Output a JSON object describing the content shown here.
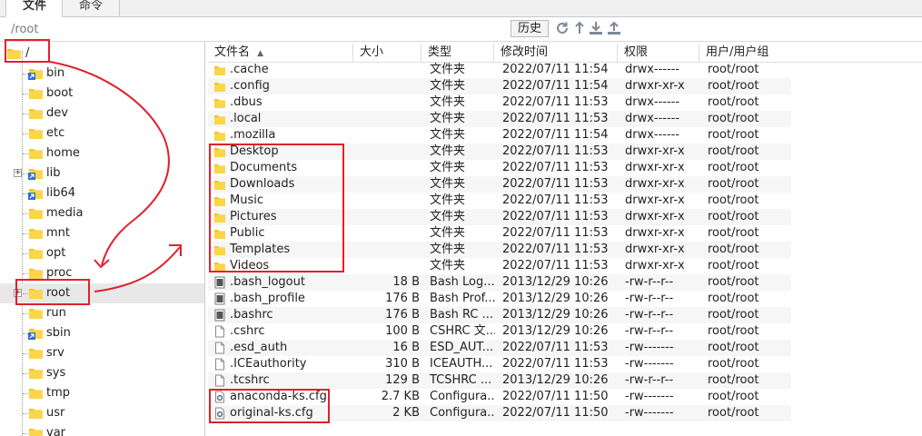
{
  "tabs": [
    {
      "label": "文件",
      "active": true
    },
    {
      "label": "命令",
      "active": false
    }
  ],
  "pathbar": {
    "path": "/root",
    "history_label": "历史"
  },
  "toolbar_icons": [
    "refresh-icon",
    "up-icon",
    "download-icon",
    "upload-icon"
  ],
  "tree": {
    "root_label": "/",
    "items": [
      {
        "label": "bin",
        "link": true,
        "expandable": false,
        "selected": false
      },
      {
        "label": "boot",
        "link": false,
        "expandable": false,
        "selected": false
      },
      {
        "label": "dev",
        "link": false,
        "expandable": false,
        "selected": false
      },
      {
        "label": "etc",
        "link": false,
        "expandable": false,
        "selected": false
      },
      {
        "label": "home",
        "link": false,
        "expandable": false,
        "selected": false
      },
      {
        "label": "lib",
        "link": true,
        "expandable": true,
        "selected": false
      },
      {
        "label": "lib64",
        "link": true,
        "expandable": false,
        "selected": false
      },
      {
        "label": "media",
        "link": false,
        "expandable": false,
        "selected": false
      },
      {
        "label": "mnt",
        "link": false,
        "expandable": false,
        "selected": false
      },
      {
        "label": "opt",
        "link": false,
        "expandable": false,
        "selected": false
      },
      {
        "label": "proc",
        "link": false,
        "expandable": false,
        "selected": false
      },
      {
        "label": "root",
        "link": false,
        "expandable": true,
        "selected": true
      },
      {
        "label": "run",
        "link": false,
        "expandable": false,
        "selected": false
      },
      {
        "label": "sbin",
        "link": true,
        "expandable": false,
        "selected": false
      },
      {
        "label": "srv",
        "link": false,
        "expandable": false,
        "selected": false
      },
      {
        "label": "sys",
        "link": false,
        "expandable": false,
        "selected": false
      },
      {
        "label": "tmp",
        "link": false,
        "expandable": false,
        "selected": false
      },
      {
        "label": "usr",
        "link": false,
        "expandable": false,
        "selected": false
      },
      {
        "label": "var",
        "link": false,
        "expandable": false,
        "selected": false
      }
    ]
  },
  "columns": [
    "文件名",
    "大小",
    "类型",
    "修改时间",
    "权限",
    "用户/用户组"
  ],
  "files": [
    {
      "icon": "folder",
      "name": ".cache",
      "size": "",
      "type": "文件夹",
      "mtime": "2022/07/11 11:54",
      "perm": "drwx------",
      "owner": "root/root"
    },
    {
      "icon": "folder",
      "name": ".config",
      "size": "",
      "type": "文件夹",
      "mtime": "2022/07/11 11:54",
      "perm": "drwxr-xr-x",
      "owner": "root/root"
    },
    {
      "icon": "folder",
      "name": ".dbus",
      "size": "",
      "type": "文件夹",
      "mtime": "2022/07/11 11:53",
      "perm": "drwx------",
      "owner": "root/root"
    },
    {
      "icon": "folder",
      "name": ".local",
      "size": "",
      "type": "文件夹",
      "mtime": "2022/07/11 11:53",
      "perm": "drwx------",
      "owner": "root/root"
    },
    {
      "icon": "folder",
      "name": ".mozilla",
      "size": "",
      "type": "文件夹",
      "mtime": "2022/07/11 11:54",
      "perm": "drwx------",
      "owner": "root/root"
    },
    {
      "icon": "folder",
      "name": "Desktop",
      "size": "",
      "type": "文件夹",
      "mtime": "2022/07/11 11:53",
      "perm": "drwxr-xr-x",
      "owner": "root/root"
    },
    {
      "icon": "folder",
      "name": "Documents",
      "size": "",
      "type": "文件夹",
      "mtime": "2022/07/11 11:53",
      "perm": "drwxr-xr-x",
      "owner": "root/root"
    },
    {
      "icon": "folder",
      "name": "Downloads",
      "size": "",
      "type": "文件夹",
      "mtime": "2022/07/11 11:53",
      "perm": "drwxr-xr-x",
      "owner": "root/root"
    },
    {
      "icon": "folder",
      "name": "Music",
      "size": "",
      "type": "文件夹",
      "mtime": "2022/07/11 11:53",
      "perm": "drwxr-xr-x",
      "owner": "root/root"
    },
    {
      "icon": "folder",
      "name": "Pictures",
      "size": "",
      "type": "文件夹",
      "mtime": "2022/07/11 11:53",
      "perm": "drwxr-xr-x",
      "owner": "root/root"
    },
    {
      "icon": "folder",
      "name": "Public",
      "size": "",
      "type": "文件夹",
      "mtime": "2022/07/11 11:53",
      "perm": "drwxr-xr-x",
      "owner": "root/root"
    },
    {
      "icon": "folder",
      "name": "Templates",
      "size": "",
      "type": "文件夹",
      "mtime": "2022/07/11 11:53",
      "perm": "drwxr-xr-x",
      "owner": "root/root"
    },
    {
      "icon": "folder",
      "name": "Videos",
      "size": "",
      "type": "文件夹",
      "mtime": "2022/07/11 11:53",
      "perm": "drwxr-xr-x",
      "owner": "root/root"
    },
    {
      "icon": "doc",
      "name": ".bash_logout",
      "size": "18 B",
      "type": "Bash Log...",
      "mtime": "2013/12/29 10:26",
      "perm": "-rw-r--r--",
      "owner": "root/root"
    },
    {
      "icon": "doc",
      "name": ".bash_profile",
      "size": "176 B",
      "type": "Bash Prof...",
      "mtime": "2013/12/29 10:26",
      "perm": "-rw-r--r--",
      "owner": "root/root"
    },
    {
      "icon": "doc",
      "name": ".bashrc",
      "size": "176 B",
      "type": "Bash RC ...",
      "mtime": "2013/12/29 10:26",
      "perm": "-rw-r--r--",
      "owner": "root/root"
    },
    {
      "icon": "blank",
      "name": ".cshrc",
      "size": "100 B",
      "type": "CSHRC 文...",
      "mtime": "2013/12/29 10:26",
      "perm": "-rw-r--r--",
      "owner": "root/root"
    },
    {
      "icon": "blank",
      "name": ".esd_auth",
      "size": "16 B",
      "type": "ESD_AUT...",
      "mtime": "2022/07/11 11:53",
      "perm": "-rw-------",
      "owner": "root/root"
    },
    {
      "icon": "blank",
      "name": ".ICEauthority",
      "size": "310 B",
      "type": "ICEAUTH...",
      "mtime": "2022/07/11 11:53",
      "perm": "-rw-------",
      "owner": "root/root"
    },
    {
      "icon": "blank",
      "name": ".tcshrc",
      "size": "129 B",
      "type": "TCSHRC ...",
      "mtime": "2013/12/29 10:26",
      "perm": "-rw-r--r--",
      "owner": "root/root"
    },
    {
      "icon": "cfg",
      "name": "anaconda-ks.cfg",
      "size": "2.7 KB",
      "type": "Configura...",
      "mtime": "2022/07/11 11:50",
      "perm": "-rw-------",
      "owner": "root/root"
    },
    {
      "icon": "cfg",
      "name": "original-ks.cfg",
      "size": "2 KB",
      "type": "Configura...",
      "mtime": "2022/07/11 11:50",
      "perm": "-rw-------",
      "owner": "root/root"
    }
  ],
  "colors": {
    "folder": "#f5c518",
    "annotation": "#e2202c",
    "selected_row": "#e8e8e8"
  }
}
